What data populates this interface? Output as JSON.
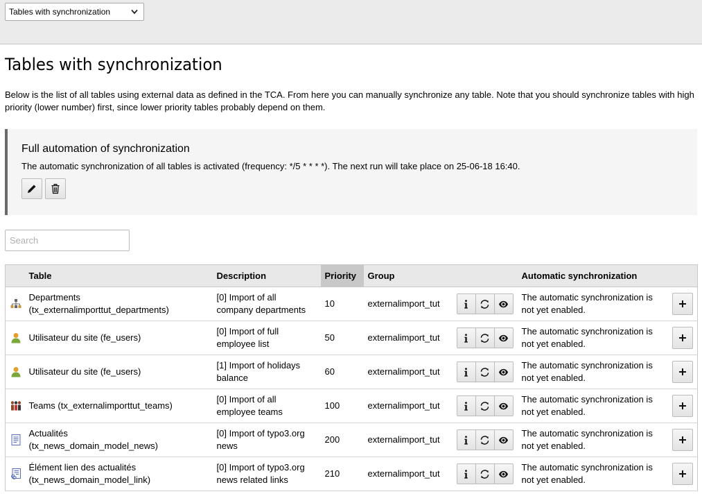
{
  "menu": {
    "selected": "Tables with synchronization"
  },
  "page": {
    "title": "Tables with synchronization",
    "intro": "Below is the list of all tables using external data as defined in the TCA. From here you can manually synchronize any table. Note that you should synchronize tables with high priority (lower number) first, since lower priority tables probably depend on them."
  },
  "automation": {
    "heading": "Full automation of synchronization",
    "text": "The automatic synchronization of all tables is activated (frequency: */5 * * * *). The next run will take place on 25-06-18 16:40."
  },
  "search": {
    "placeholder": "Search"
  },
  "table": {
    "headers": {
      "table": "Table",
      "description": "Description",
      "priority": "Priority",
      "group": "Group",
      "automatic": "Automatic synchronization"
    },
    "rows": [
      {
        "icon": "sitemap-icon",
        "table_line1": "Departments",
        "table_line2": "(tx_externalimporttut_departments)",
        "desc_line1": "[0] Import of all",
        "desc_line2": "company departments",
        "priority": "10",
        "group": "externalimport_tut",
        "auto_line1": "The automatic synchronization is",
        "auto_line2": "not yet enabled."
      },
      {
        "icon": "user-icon",
        "table_line1": "Utilisateur du site (fe_users)",
        "table_line2": "",
        "desc_line1": "[0] Import of full",
        "desc_line2": "employee list",
        "priority": "50",
        "group": "externalimport_tut",
        "auto_line1": "The automatic synchronization is",
        "auto_line2": "not yet enabled."
      },
      {
        "icon": "user-icon",
        "table_line1": "Utilisateur du site (fe_users)",
        "table_line2": "",
        "desc_line1": "[1] Import of holidays",
        "desc_line2": "balance",
        "priority": "60",
        "group": "externalimport_tut",
        "auto_line1": "The automatic synchronization is",
        "auto_line2": "not yet enabled."
      },
      {
        "icon": "team-icon",
        "table_line1": "Teams (tx_externalimporttut_teams)",
        "table_line2": "",
        "desc_line1": "[0] Import of all",
        "desc_line2": "employee teams",
        "priority": "100",
        "group": "externalimport_tut",
        "auto_line1": "The automatic synchronization is",
        "auto_line2": "not yet enabled."
      },
      {
        "icon": "news-icon",
        "table_line1": "Actualités",
        "table_line2": "(tx_news_domain_model_news)",
        "desc_line1": "[0] Import of typo3.org",
        "desc_line2": "news",
        "priority": "200",
        "group": "externalimport_tut",
        "auto_line1": "The automatic synchronization is",
        "auto_line2": "not yet enabled."
      },
      {
        "icon": "news-link-icon",
        "table_line1": "Élément lien des actualités",
        "table_line2": "(tx_news_domain_model_link)",
        "desc_line1": "[0] Import of typo3.org",
        "desc_line2": "news related links",
        "priority": "210",
        "group": "externalimport_tut",
        "auto_line1": "The automatic synchronization is",
        "auto_line2": "not yet enabled."
      }
    ]
  },
  "colors": {
    "callout_border": "#6a6a6a",
    "header_bg": "#e8e8e8",
    "sorted_header_bg": "#c8c8c8"
  }
}
